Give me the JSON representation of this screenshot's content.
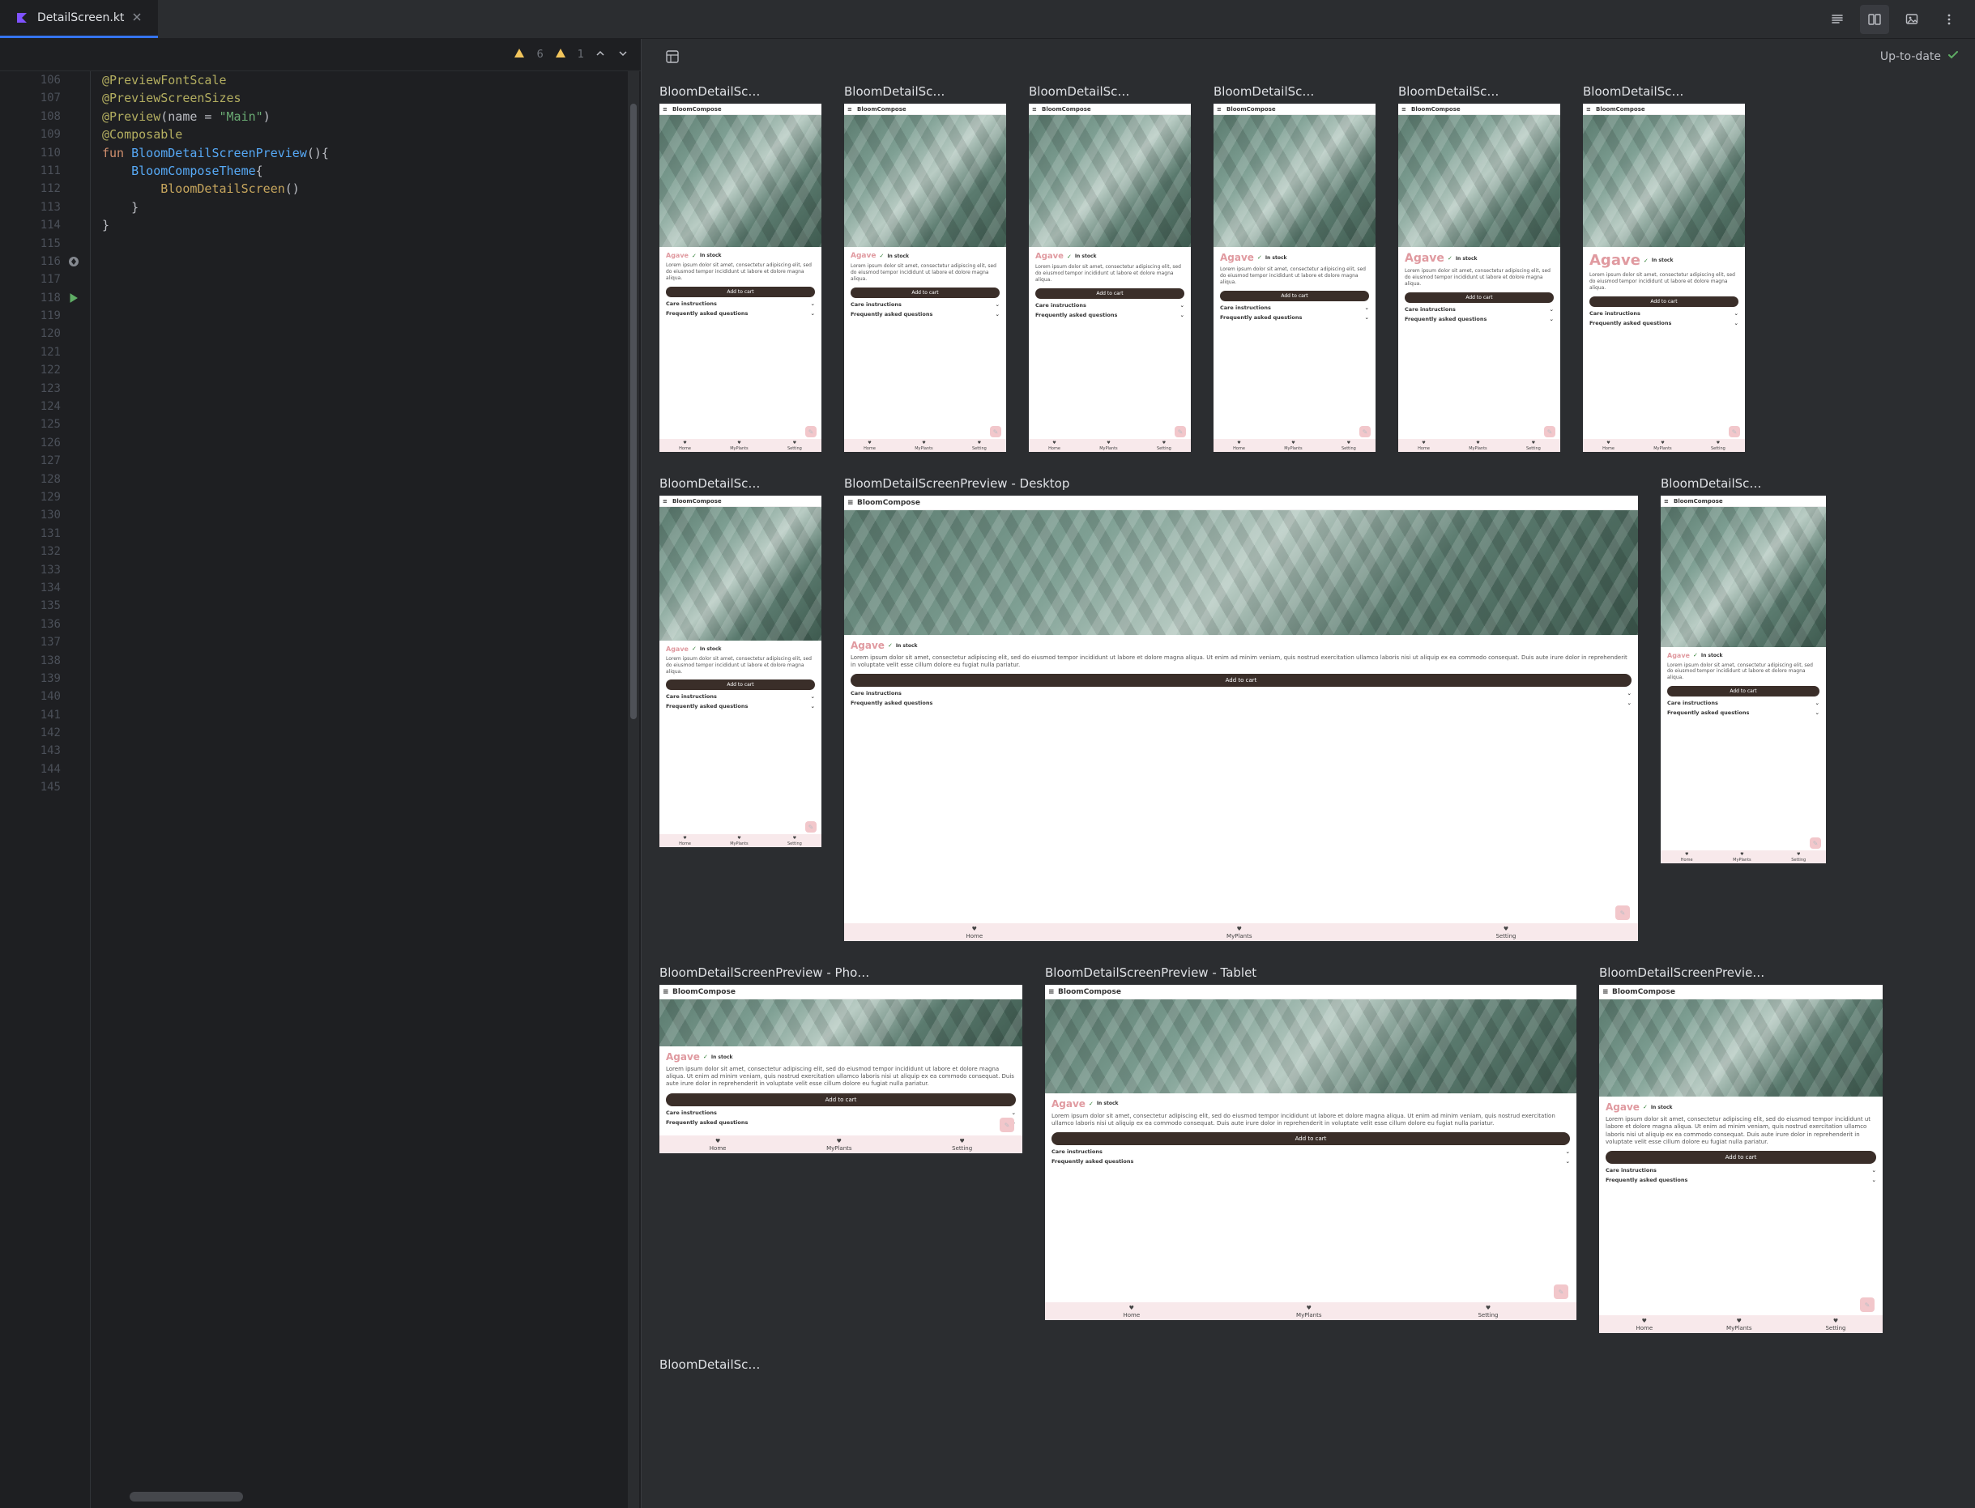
{
  "tab": {
    "filename": "DetailScreen.kt"
  },
  "inspection": {
    "warnType1Count": "6",
    "warnType2Count": "1"
  },
  "preview": {
    "status": "Up-to-date"
  },
  "code": {
    "firstLine": 106,
    "lastLine": 145,
    "lines": {
      "114": {
        "anno": "@PreviewFontScale"
      },
      "115": {
        "anno": "@PreviewScreenSizes"
      },
      "116": {
        "anno": "@Preview",
        "args_pre": "(name = ",
        "str": "\"Main\"",
        "args_post": ")"
      },
      "117": {
        "anno": "@Composable"
      },
      "118": {
        "kw": "fun ",
        "fn": "BloomDetailScreenPreview",
        "post": "(){"
      },
      "119": {
        "indent": "    ",
        "call": "BloomComposeTheme",
        "post": "{"
      },
      "120": {
        "indent": "        ",
        "call": "BloomDetailScreen",
        "post": "()"
      },
      "121": {
        "indent": "    ",
        "plain": "}"
      },
      "122": {
        "plain": "}"
      }
    }
  },
  "app": {
    "name": "BloomCompose",
    "plant": "Agave",
    "stock": "In stock",
    "lorem_short": "Lorem ipsum dolor sit amet, consectetur adipiscing elit, sed do eiusmod tempor incididunt ut labore et dolore magna aliqua.",
    "lorem_long": "Lorem ipsum dolor sit amet, consectetur adipiscing elit, sed do eiusmod tempor incididunt ut labore et dolore magna aliqua. Ut enim ad minim veniam, quis nostrud exercitation ullamco laboris nisi ut aliquip ex ea commodo consequat. Duis aute irure dolor in reprehenderit in voluptate velit esse cillum dolore eu fugiat nulla pariatur.",
    "add_to_cart": "Add to cart",
    "care": "Care instructions",
    "faq": "Frequently asked questions",
    "nav": {
      "home": "Home",
      "myplants": "MyPlants",
      "setting": "Setting"
    }
  },
  "previews": {
    "row1": [
      {
        "label": "BloomDetailSc…"
      },
      {
        "label": "BloomDetailSc…"
      },
      {
        "label": "BloomDetailSc…"
      },
      {
        "label": "BloomDetailSc…"
      },
      {
        "label": "BloomDetailSc…"
      },
      {
        "label": "BloomDetailSc…"
      }
    ],
    "row2": [
      {
        "label": "BloomDetailSc…"
      },
      {
        "label": "BloomDetailScreenPreview - Desktop"
      },
      {
        "label": "BloomDetailSc…"
      }
    ],
    "row3": [
      {
        "label": "BloomDetailScreenPreview - Pho…"
      },
      {
        "label": "BloomDetailScreenPreview - Tablet"
      },
      {
        "label": "BloomDetailScreenPrevie…"
      }
    ],
    "row4": [
      {
        "label": "BloomDetailSc…"
      }
    ]
  }
}
